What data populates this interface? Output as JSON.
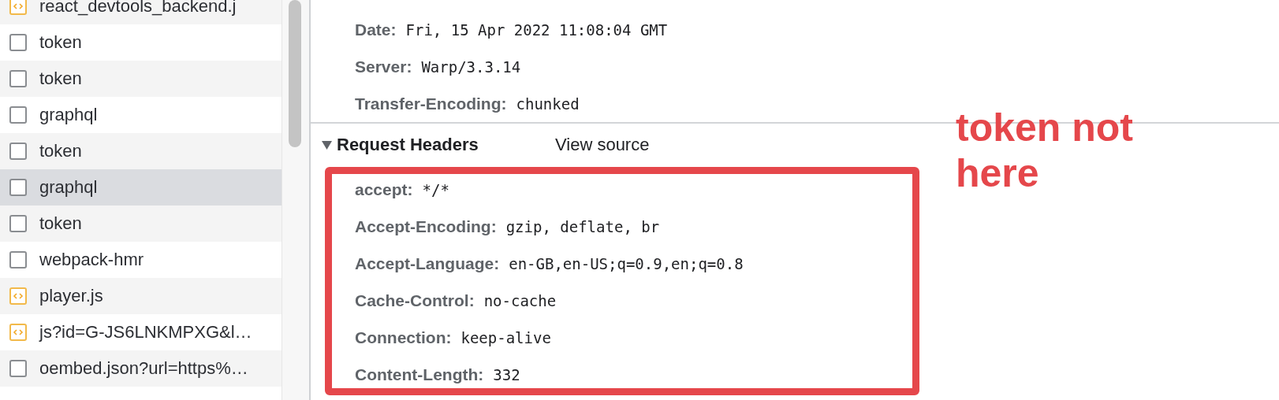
{
  "requests": [
    {
      "name": "react_devtools_backend.j",
      "kind": "script",
      "selected": false
    },
    {
      "name": "token",
      "kind": "document",
      "selected": false
    },
    {
      "name": "token",
      "kind": "document",
      "selected": false
    },
    {
      "name": "graphql",
      "kind": "document",
      "selected": false
    },
    {
      "name": "token",
      "kind": "document",
      "selected": false
    },
    {
      "name": "graphql",
      "kind": "document",
      "selected": true
    },
    {
      "name": "token",
      "kind": "document",
      "selected": false
    },
    {
      "name": "webpack-hmr",
      "kind": "document",
      "selected": false
    },
    {
      "name": "player.js",
      "kind": "script",
      "selected": false
    },
    {
      "name": "js?id=G-JS6LNKMPXG&l…",
      "kind": "script",
      "selected": false
    },
    {
      "name": "oembed.json?url=https%…",
      "kind": "document",
      "selected": false
    }
  ],
  "response_headers": [
    {
      "name": "Date:",
      "value": "Fri, 15 Apr 2022 11:08:04 GMT"
    },
    {
      "name": "Server:",
      "value": "Warp/3.3.14"
    },
    {
      "name": "Transfer-Encoding:",
      "value": "chunked"
    }
  ],
  "request_headers": {
    "title": "Request Headers",
    "expanded": true,
    "view_source": "View source",
    "headers": [
      {
        "name": "accept:",
        "value": "*/*"
      },
      {
        "name": "Accept-Encoding:",
        "value": "gzip, deflate, br"
      },
      {
        "name": "Accept-Language:",
        "value": "en-GB,en-US;q=0.9,en;q=0.8"
      },
      {
        "name": "Cache-Control:",
        "value": "no-cache"
      },
      {
        "name": "Connection:",
        "value": "keep-alive"
      },
      {
        "name": "Content-Length:",
        "value": "332"
      }
    ]
  },
  "annotation": {
    "text": "token not here"
  }
}
